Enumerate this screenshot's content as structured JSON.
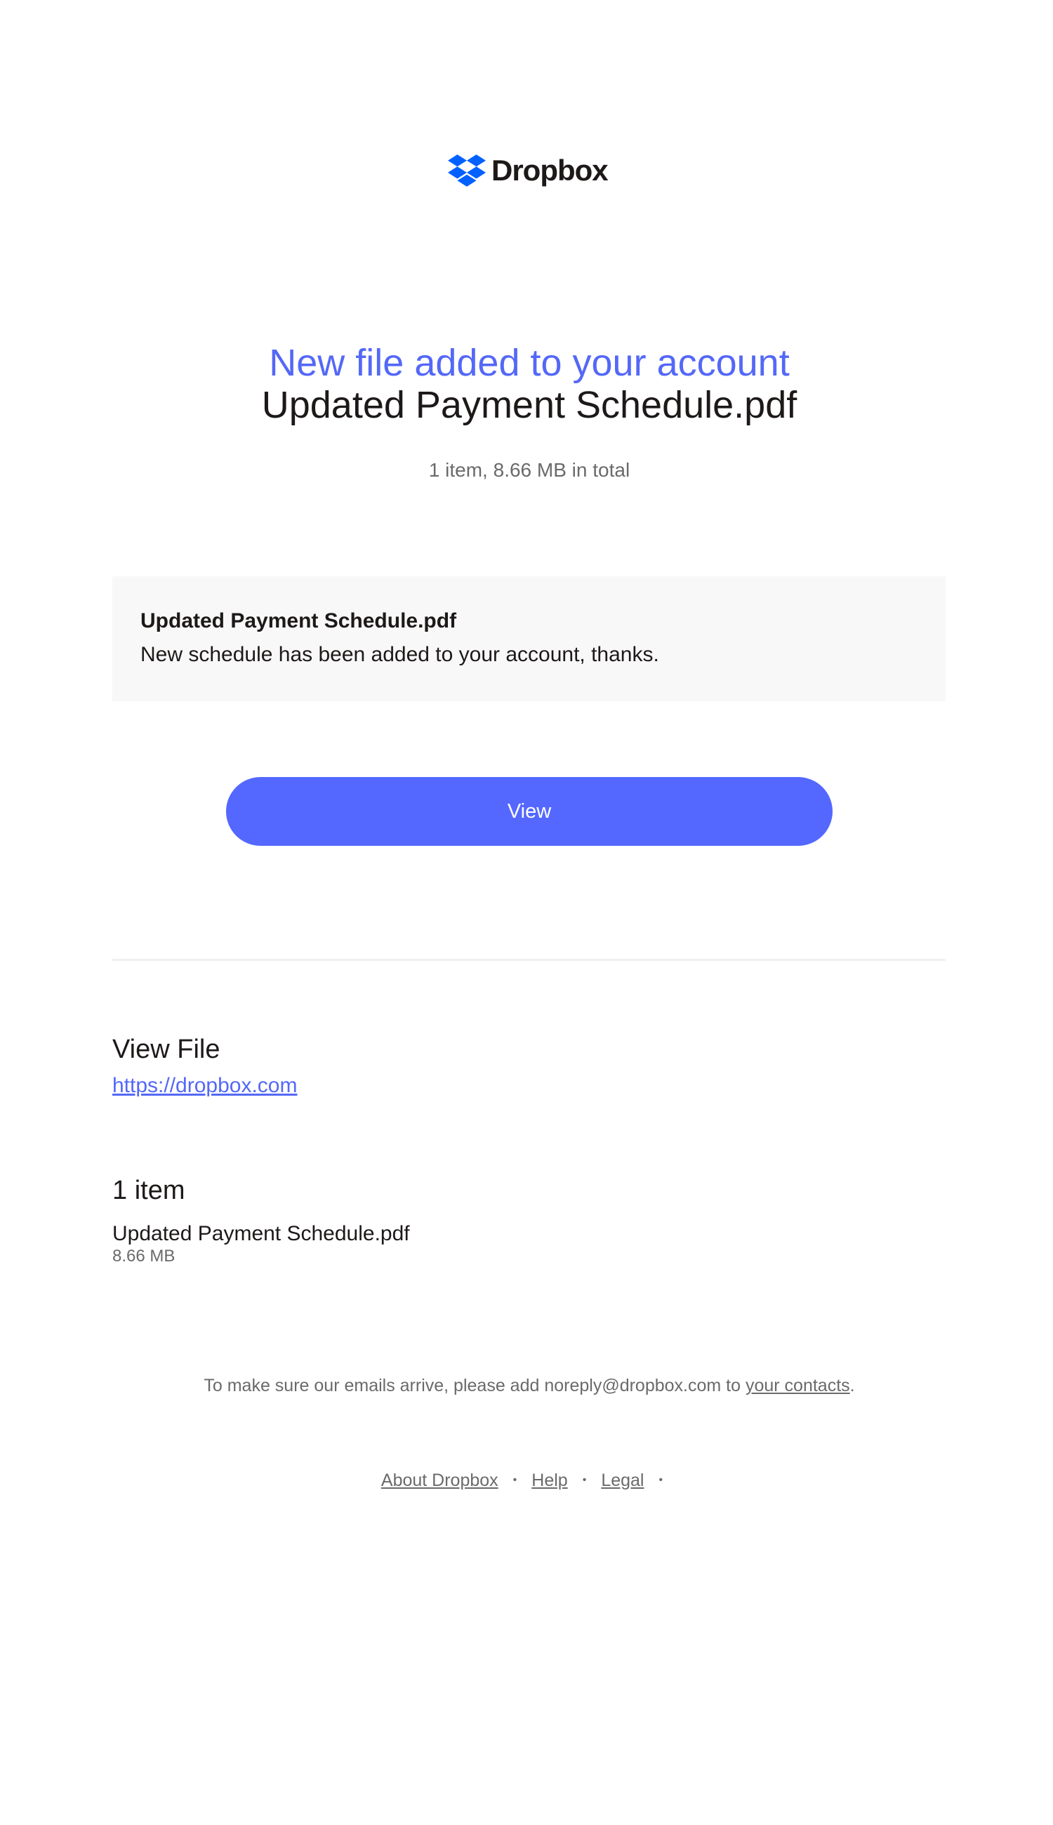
{
  "brand": {
    "name": "Dropbox",
    "logo_icon": "dropbox-box-icon",
    "accent": "#0061ff"
  },
  "header": {
    "headline": "New file added to your account",
    "file_title": "Updated Payment Schedule.pdf",
    "summary": "1 item, 8.66 MB in total"
  },
  "message": {
    "title": "Updated Payment Schedule.pdf",
    "body": "New schedule has been added to your account, thanks."
  },
  "actions": {
    "view_label": "View",
    "button_color": "#5468ff"
  },
  "view_file": {
    "heading": "View File",
    "link_text": "https://dropbox.com"
  },
  "items": {
    "heading": "1 item",
    "list": [
      {
        "name": "Updated Payment Schedule.pdf",
        "size": "8.66 MB"
      }
    ]
  },
  "footer": {
    "note_prefix": "To make sure our emails arrive, please add noreply@dropbox.com to ",
    "note_link": "your contacts",
    "note_suffix": ".",
    "links": [
      "About Dropbox",
      "Help",
      "Legal"
    ],
    "separator": "•"
  }
}
